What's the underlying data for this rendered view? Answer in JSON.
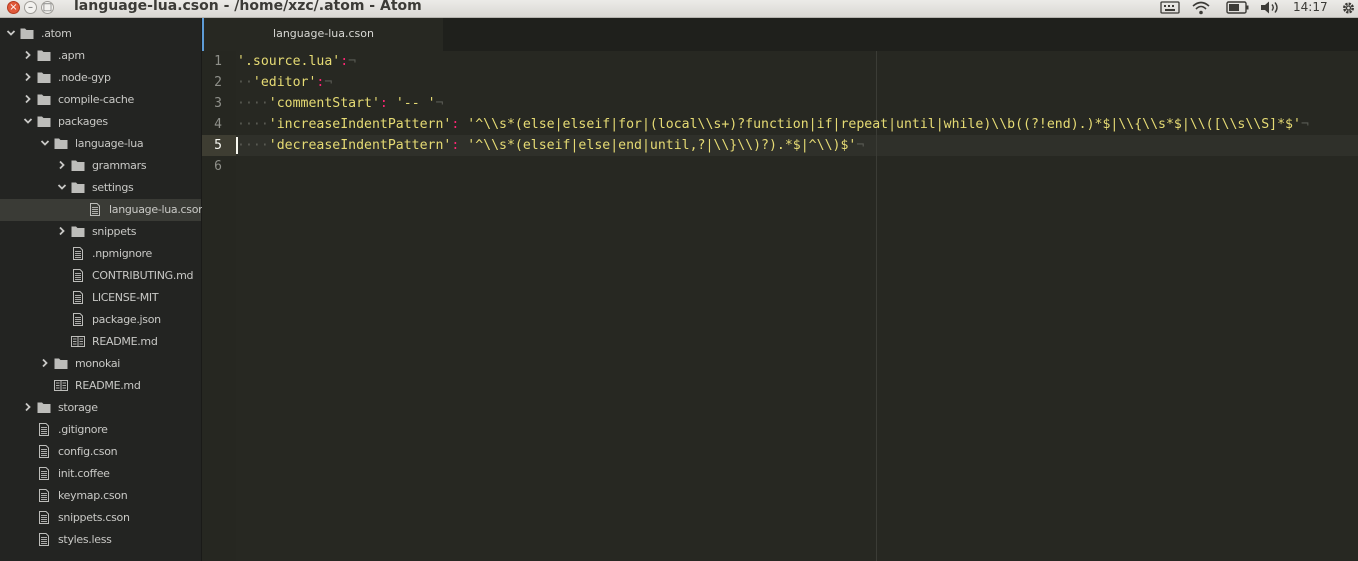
{
  "window": {
    "title": "language-lua.cson - /home/xzc/.atom - Atom",
    "clock": "14:17"
  },
  "tray_icons": [
    "keyboard-icon",
    "wifi-icon",
    "battery-icon",
    "volume-icon",
    "gear-icon"
  ],
  "sidebar": {
    "items": [
      {
        "label": ".atom",
        "kind": "folder",
        "expanded": true,
        "depth": 0
      },
      {
        "label": ".apm",
        "kind": "folder",
        "expanded": false,
        "depth": 1
      },
      {
        "label": ".node-gyp",
        "kind": "folder",
        "expanded": false,
        "depth": 1
      },
      {
        "label": "compile-cache",
        "kind": "folder",
        "expanded": false,
        "depth": 1
      },
      {
        "label": "packages",
        "kind": "folder",
        "expanded": true,
        "depth": 1
      },
      {
        "label": "language-lua",
        "kind": "folder",
        "expanded": true,
        "depth": 2
      },
      {
        "label": "grammars",
        "kind": "folder",
        "expanded": false,
        "depth": 3
      },
      {
        "label": "settings",
        "kind": "folder",
        "expanded": true,
        "depth": 3
      },
      {
        "label": "language-lua.cson",
        "kind": "file",
        "depth": 4,
        "selected": true
      },
      {
        "label": "snippets",
        "kind": "folder",
        "expanded": false,
        "depth": 3
      },
      {
        "label": ".npmignore",
        "kind": "file",
        "depth": 3
      },
      {
        "label": "CONTRIBUTING.md",
        "kind": "file",
        "depth": 3
      },
      {
        "label": "LICENSE-MIT",
        "kind": "file",
        "depth": 3
      },
      {
        "label": "package.json",
        "kind": "file",
        "depth": 3
      },
      {
        "label": "README.md",
        "kind": "readme",
        "depth": 3
      },
      {
        "label": "monokai",
        "kind": "folder",
        "expanded": false,
        "depth": 2
      },
      {
        "label": "README.md",
        "kind": "readme",
        "depth": 2
      },
      {
        "label": "storage",
        "kind": "folder",
        "expanded": false,
        "depth": 1
      },
      {
        "label": ".gitignore",
        "kind": "file",
        "depth": 1
      },
      {
        "label": "config.cson",
        "kind": "file",
        "depth": 1
      },
      {
        "label": "init.coffee",
        "kind": "file",
        "depth": 1
      },
      {
        "label": "keymap.cson",
        "kind": "file",
        "depth": 1
      },
      {
        "label": "snippets.cson",
        "kind": "file",
        "depth": 1
      },
      {
        "label": "styles.less",
        "kind": "file",
        "depth": 1
      }
    ]
  },
  "tabs": [
    {
      "label": "language-lua.cson",
      "active": true
    }
  ],
  "editor": {
    "current_line": 5,
    "lines": [
      {
        "number": "1",
        "tokens": [
          {
            "t": "s",
            "v": "'.source.lua'"
          },
          {
            "t": "p",
            "v": ":"
          },
          {
            "t": "inv",
            "v": "¬"
          }
        ]
      },
      {
        "number": "2",
        "tokens": [
          {
            "t": "inv",
            "v": "··"
          },
          {
            "t": "s",
            "v": "'editor'"
          },
          {
            "t": "p",
            "v": ":"
          },
          {
            "t": "inv",
            "v": "¬"
          }
        ]
      },
      {
        "number": "3",
        "tokens": [
          {
            "t": "inv",
            "v": "····"
          },
          {
            "t": "s",
            "v": "'commentStart'"
          },
          {
            "t": "p",
            "v": ":"
          },
          {
            "t": "s",
            "v": " '-- '"
          },
          {
            "t": "inv",
            "v": "¬"
          }
        ]
      },
      {
        "number": "4",
        "tokens": [
          {
            "t": "inv",
            "v": "····"
          },
          {
            "t": "s",
            "v": "'increaseIndentPattern'"
          },
          {
            "t": "p",
            "v": ":"
          },
          {
            "t": "s",
            "v": " '^\\\\s*(else|elseif|for|(local\\\\s+)?function|if|repeat|until|while)\\\\b((?!end).)*$|\\\\{\\\\s*$|\\\\([\\\\s\\\\S]*$'"
          },
          {
            "t": "inv",
            "v": "¬"
          }
        ]
      },
      {
        "number": "5",
        "tokens": [
          {
            "t": "inv",
            "v": "····"
          },
          {
            "t": "s",
            "v": "'decreaseIndentPattern'"
          },
          {
            "t": "p",
            "v": ":"
          },
          {
            "t": "s",
            "v": " '^\\\\s*(elseif|else|end|until,?|\\\\}\\\\)?).*$|^\\\\)$'"
          },
          {
            "t": "inv",
            "v": "¬"
          }
        ]
      },
      {
        "number": "6",
        "tokens": []
      }
    ]
  }
}
